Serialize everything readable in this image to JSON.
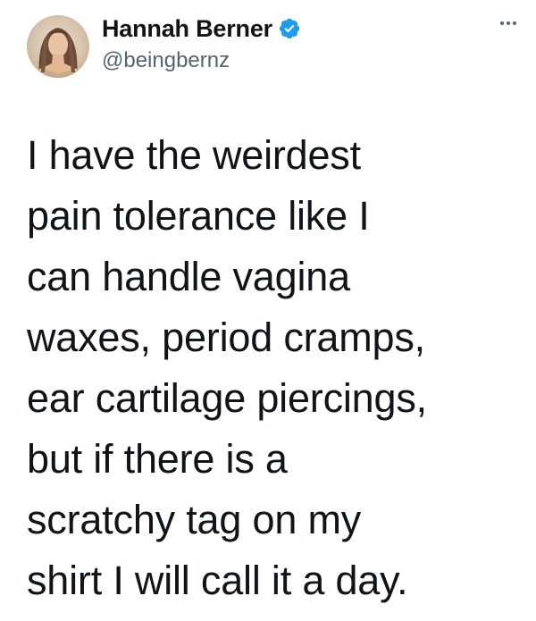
{
  "author": {
    "display_name": "Hannah Berner",
    "handle": "@beingbernz",
    "verified": true,
    "avatar_icon": "profile-photo",
    "verified_icon": "verified-badge-icon",
    "verified_color": "#1d9bf0"
  },
  "menu": {
    "more_icon": "more-horizontal-icon"
  },
  "tweet": {
    "lines": [
      "I have the weirdest",
      "pain tolerance like I",
      "can handle vagina",
      "waxes, period cramps,",
      "ear cartilage piercings,",
      "but if there is a",
      "scratchy tag on my",
      "shirt I will call it a day."
    ]
  },
  "colors": {
    "text_primary": "#0f1419",
    "text_secondary": "#536471",
    "background": "#ffffff"
  }
}
